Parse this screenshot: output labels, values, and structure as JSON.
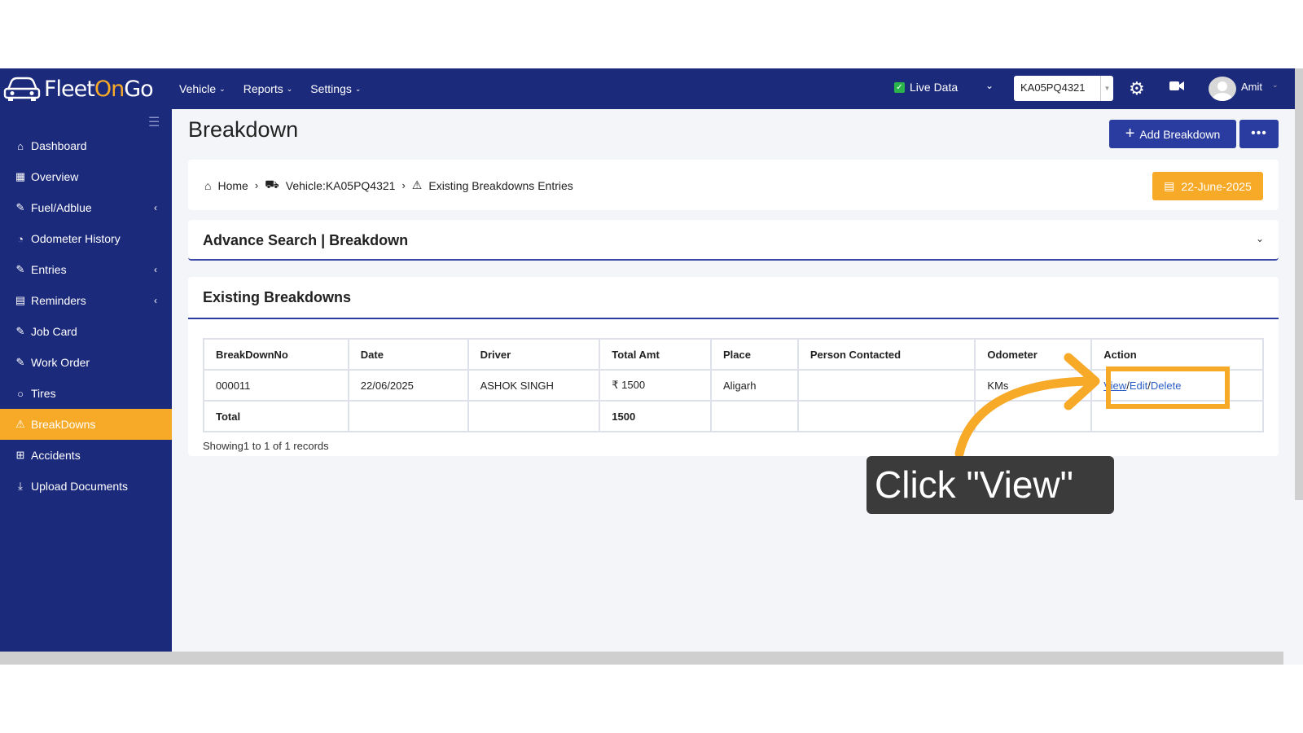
{
  "app": {
    "logo_part1": "Fleet",
    "logo_part2": "On",
    "logo_part3": "Go"
  },
  "topnav": {
    "menus": [
      "Vehicle",
      "Reports",
      "Settings"
    ],
    "live_data_label": "Live Data",
    "vehicle_select": "KA05PQ4321",
    "user_name": "Amit"
  },
  "sidebar": {
    "items": [
      {
        "label": "Dashboard",
        "icon": "home-icon"
      },
      {
        "label": "Overview",
        "icon": "grid-icon"
      },
      {
        "label": "Fuel/Adblue",
        "icon": "edit-icon"
      },
      {
        "label": "Odometer History",
        "icon": "gauge-icon"
      },
      {
        "label": "Entries",
        "icon": "edit-icon"
      },
      {
        "label": "Reminders",
        "icon": "calendar-icon"
      },
      {
        "label": "Job Card",
        "icon": "edit-icon"
      },
      {
        "label": "Work Order",
        "icon": "edit-icon"
      },
      {
        "label": "Tires",
        "icon": "circle-icon"
      },
      {
        "label": "BreakDowns",
        "icon": "warning-icon"
      },
      {
        "label": "Accidents",
        "icon": "plus-square-icon"
      },
      {
        "label": "Upload Documents",
        "icon": "download-icon"
      }
    ],
    "active": "BreakDowns"
  },
  "page": {
    "title": "Breakdown",
    "add_button": "Add Breakdown",
    "more_button": "•••",
    "breadcrumb": [
      "Home",
      "Vehicle:KA05PQ4321",
      "Existing Breakdowns Entries"
    ],
    "date_button": "22-June-2025"
  },
  "advance_search": {
    "title": "Advance Search | Breakdown"
  },
  "existing": {
    "title": "Existing Breakdowns",
    "headers": [
      "BreakDownNo",
      "Date",
      "Driver",
      "Total Amt",
      "Place",
      "Person Contacted",
      "Odometer",
      "Action"
    ],
    "rows": [
      {
        "no": "000011",
        "date": "22/06/2025",
        "driver": "ASHOK SINGH",
        "amount": "₹ 1500",
        "place": "Aligarh",
        "person": "",
        "odometer": "KMs",
        "view": "View",
        "edit": "Edit",
        "delete": "Delete"
      }
    ],
    "total_label": "Total",
    "total_value": "1500",
    "showing": "Showing1 to 1 of 1 records"
  },
  "annotation": {
    "text": "Click \"View\""
  },
  "colors": {
    "nav": "#1c2a7c",
    "accent": "#f7a928",
    "button": "#2a3ca0"
  }
}
